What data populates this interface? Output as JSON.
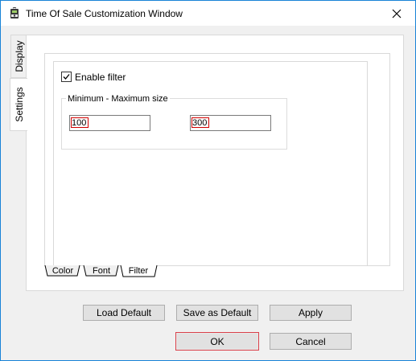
{
  "window": {
    "title": "Time Of Sale Customization Window",
    "app_icon": "bell-icon",
    "close_icon": "close-icon",
    "accent_border": "#1883d7"
  },
  "side_tabs": [
    {
      "label": "Display",
      "active": false
    },
    {
      "label": "Settings",
      "active": true
    }
  ],
  "settings": {
    "enable_filter_label": "Enable filter",
    "enable_filter_checked": true,
    "group_title": "Minimum - Maximum size",
    "min_value": "100",
    "max_value": "300",
    "field_highlight_color": "#d00000"
  },
  "bottom_tabs": [
    {
      "label": "Color",
      "active": false
    },
    {
      "label": "Font",
      "active": false
    },
    {
      "label": "Filter",
      "active": true
    }
  ],
  "buttons": {
    "load_default": "Load Default",
    "save_as_default": "Save as Default",
    "apply": "Apply",
    "ok": "OK",
    "cancel": "Cancel",
    "ok_focus_color": "#d9404a"
  }
}
